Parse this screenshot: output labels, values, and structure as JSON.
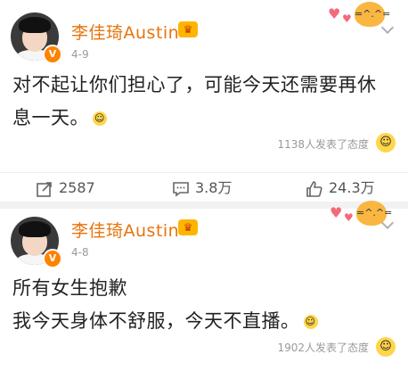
{
  "posts": [
    {
      "author": "李佳琦Austin",
      "date": "4-9",
      "lines": [
        "对不起让你们担心了，可能今天还需要再休",
        "息一天。"
      ],
      "likes_text": "1138人发表了态度"
    },
    {
      "author": "李佳琦Austin",
      "date": "4-8",
      "lines": [
        "所有女生抱歉",
        "我今天身体不舒服，今天不直播。"
      ],
      "likes_text": "1902人发表了态度"
    }
  ],
  "stats": {
    "reposts": "2587",
    "comments": "3.8万",
    "likes": "24.3万"
  },
  "icons": {
    "verified": "verified-badge-icon",
    "crown": "vip-crown-icon",
    "repost": "repost-icon",
    "comment": "comment-icon",
    "like": "thumbs-up-icon",
    "more": "chevron-down-icon",
    "reaction": "smiley-emoji-icon"
  },
  "colors": {
    "author": "#e8730c",
    "badge": "#ff8200",
    "meta": "#9a9a9a"
  }
}
